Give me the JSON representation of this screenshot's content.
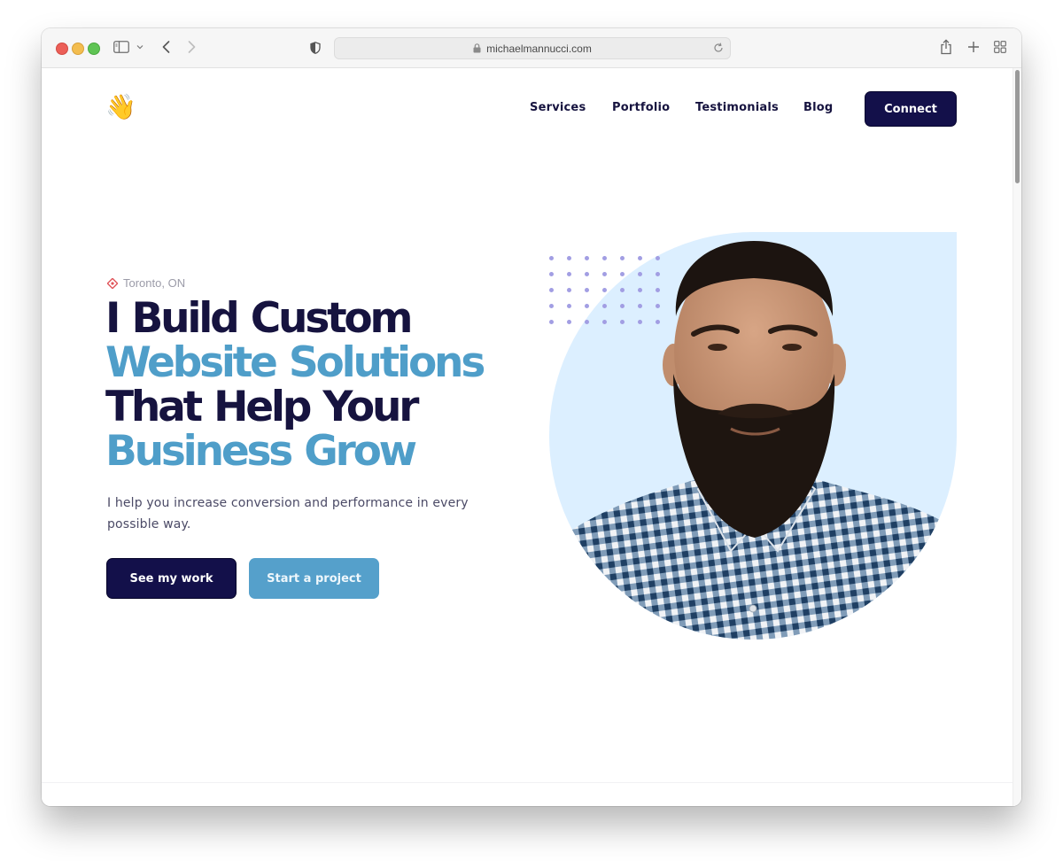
{
  "browser": {
    "url": "michaelmannucci.com",
    "icons": {
      "sidebar": "sidebar-icon",
      "chevron": "chevron-down-icon",
      "back": "back-arrow-icon",
      "forward": "forward-arrow-icon",
      "privacy": "shield-icon",
      "lock": "lock-icon",
      "reload": "reload-icon",
      "share": "share-icon",
      "new_tab": "plus-icon",
      "tab_overview": "grid-icon"
    }
  },
  "header": {
    "logo_emoji": "👋",
    "nav": [
      {
        "label": "Services"
      },
      {
        "label": "Portfolio"
      },
      {
        "label": "Testimonials"
      },
      {
        "label": "Blog"
      }
    ],
    "cta_label": "Connect"
  },
  "hero": {
    "location": "Toronto, ON",
    "headline": [
      {
        "text": "I Build Custom",
        "tone": "dark"
      },
      {
        "text": "Website Solutions",
        "tone": "blue"
      },
      {
        "text": "That Help Your",
        "tone": "dark"
      },
      {
        "text": "Business Grow",
        "tone": "blue"
      }
    ],
    "subtitle": "I help you increase conversion and performance in every possible way.",
    "primary_button": "See my work",
    "secondary_button": "Start a project",
    "image_alt": "Portrait of bearded man in checked shirt"
  },
  "colors": {
    "navy": "#13104a",
    "heading_dark": "#16133f",
    "accent_blue": "#4f9ec9",
    "button_blue": "#55a0cb",
    "hero_bg": "#dcefff",
    "dots": "#a29ee3",
    "location_pin": "#e0555a"
  }
}
